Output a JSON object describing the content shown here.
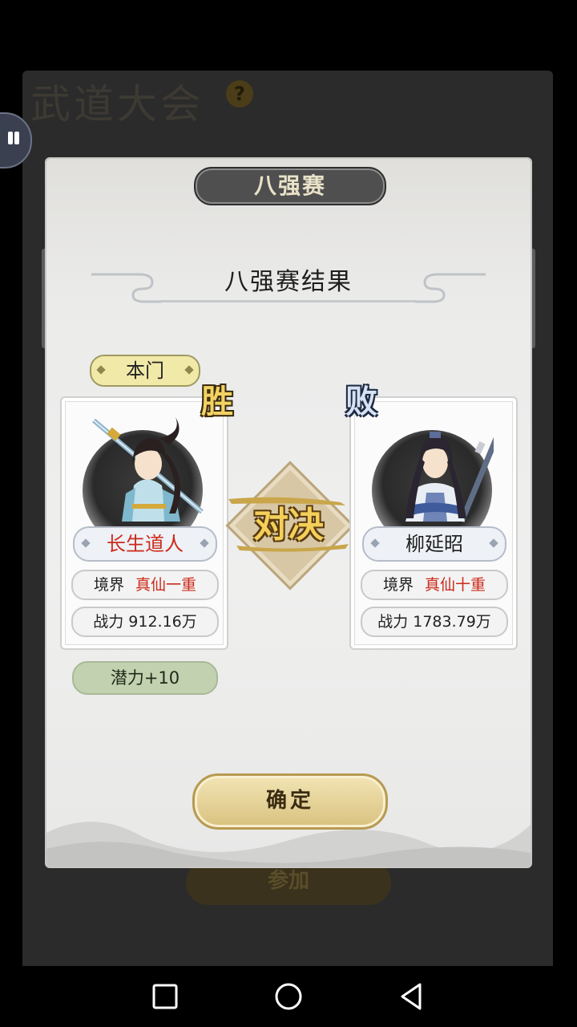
{
  "background": {
    "title": "武道大会",
    "help_icon": "?",
    "join_button": "参加"
  },
  "dialog": {
    "round_title": "八强赛",
    "result_title": "八强赛结果",
    "home_tag": "本门",
    "versus_label": "对决",
    "left_player": {
      "badge": "胜",
      "name": "长生道人",
      "realm_label": "境界",
      "realm_value": "真仙一重",
      "power_label": "战力",
      "power_value": "912.16万"
    },
    "right_player": {
      "badge": "败",
      "name": "柳延昭",
      "realm_label": "境界",
      "realm_value": "真仙十重",
      "power_label": "战力",
      "power_value": "1783.79万"
    },
    "reward": "潜力+10",
    "confirm_label": "确定"
  },
  "colors": {
    "accent_gold": "#d9c27f",
    "red_text": "#cc2a1a",
    "reward_green": "#c2d1b0"
  },
  "navbar": {
    "icons": [
      "square-icon",
      "circle-icon",
      "triangle-back-icon"
    ]
  }
}
